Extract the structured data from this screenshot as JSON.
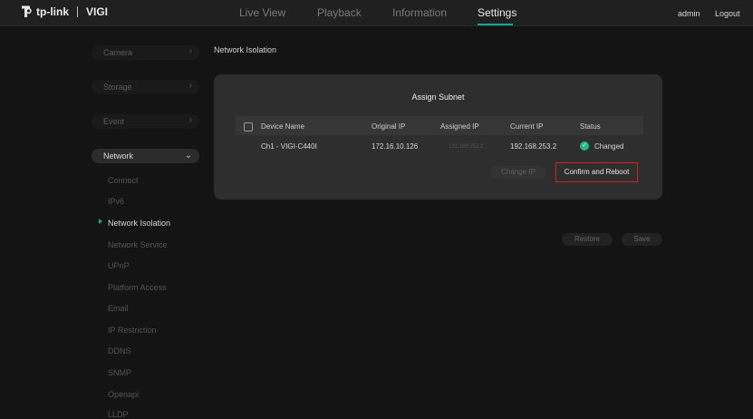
{
  "header": {
    "logo_text": "tp-link",
    "logo_product": "VIGI",
    "nav": [
      "Live View",
      "Playback",
      "Information",
      "Settings"
    ],
    "active_nav": "Settings",
    "user": "admin",
    "logout": "Logout"
  },
  "sidebar": {
    "groups": [
      {
        "label": "Camera",
        "icon": "chevron-right-icon"
      },
      {
        "label": "Storage",
        "icon": "chevron-right-icon"
      },
      {
        "label": "Event",
        "icon": "chevron-right-icon"
      },
      {
        "label": "Network",
        "icon": "chevron-down-icon"
      }
    ],
    "network_items": [
      "Connect",
      "IPv6",
      "Network Isolation",
      "Network Service",
      "UPnP",
      "Platform Access",
      "Email",
      "IP Restriction",
      "DDNS",
      "SNMP",
      "Openapi",
      "LLDP"
    ],
    "active_item": "Network Isolation"
  },
  "main": {
    "title": "Network Isolation",
    "panel": {
      "title": "Assign Subnet",
      "columns": [
        "Device Name",
        "Original IP",
        "Assigned IP",
        "Current IP",
        "Status"
      ],
      "row": {
        "device": "Ch1 - VIGI-C440I",
        "original_ip": "172.16.10.126",
        "assigned_ip": "192.168.253.2",
        "current_ip": "192.168.253.2",
        "status": "Changed"
      },
      "change_ip": "Change IP",
      "confirm": "Confirm and Reboot"
    },
    "restore": "Restore",
    "save": "Save"
  },
  "colors": {
    "accent": "#13a596",
    "highlight": "#d8202a",
    "status_ok": "#1fb98a"
  }
}
